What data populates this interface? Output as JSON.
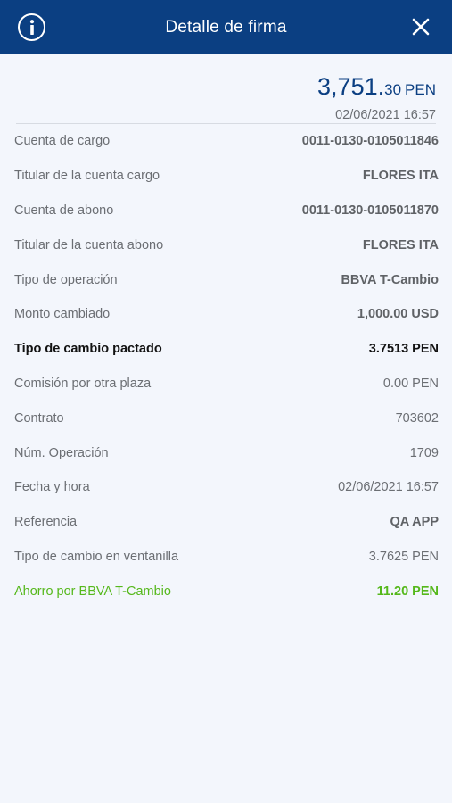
{
  "header": {
    "title": "Detalle de firma",
    "info_icon": "info-icon",
    "close_icon": "close-icon"
  },
  "summary": {
    "amount_int": "3,751.",
    "amount_dec": "30",
    "currency": "PEN",
    "datetime": "02/06/2021 16:57"
  },
  "details": [
    {
      "label": "Cuenta de cargo",
      "value": "0011-0130-0105011846"
    },
    {
      "label": "Titular de la cuenta cargo",
      "value": "FLORES ITA"
    },
    {
      "label": "Cuenta de abono",
      "value": "0011-0130-0105011870"
    },
    {
      "label": "Titular de la cuenta abono",
      "value": "FLORES ITA"
    },
    {
      "label": "Tipo de operación",
      "value": "BBVA T-Cambio"
    },
    {
      "label": "Monto cambiado",
      "value": "1,000.00 USD"
    },
    {
      "label": "Tipo de cambio pactado",
      "value": "3.7513 PEN"
    },
    {
      "label": "Comisión por otra plaza",
      "value": "0.00 PEN"
    },
    {
      "label": "Contrato",
      "value": "703602"
    },
    {
      "label": "Núm. Operación",
      "value": "1709"
    },
    {
      "label": "Fecha y hora",
      "value": "02/06/2021 16:57"
    },
    {
      "label": "Referencia",
      "value": "QA APP"
    },
    {
      "label": "Tipo de cambio en ventanilla",
      "value": "3.7625 PEN"
    },
    {
      "label": "Ahorro por BBVA T-Cambio",
      "value": "11.20 PEN"
    }
  ],
  "colors": {
    "header_bg": "#0b3f82",
    "page_bg": "#f3f6fc",
    "amount": "#0b3f82",
    "savings_green": "#55b81b"
  }
}
